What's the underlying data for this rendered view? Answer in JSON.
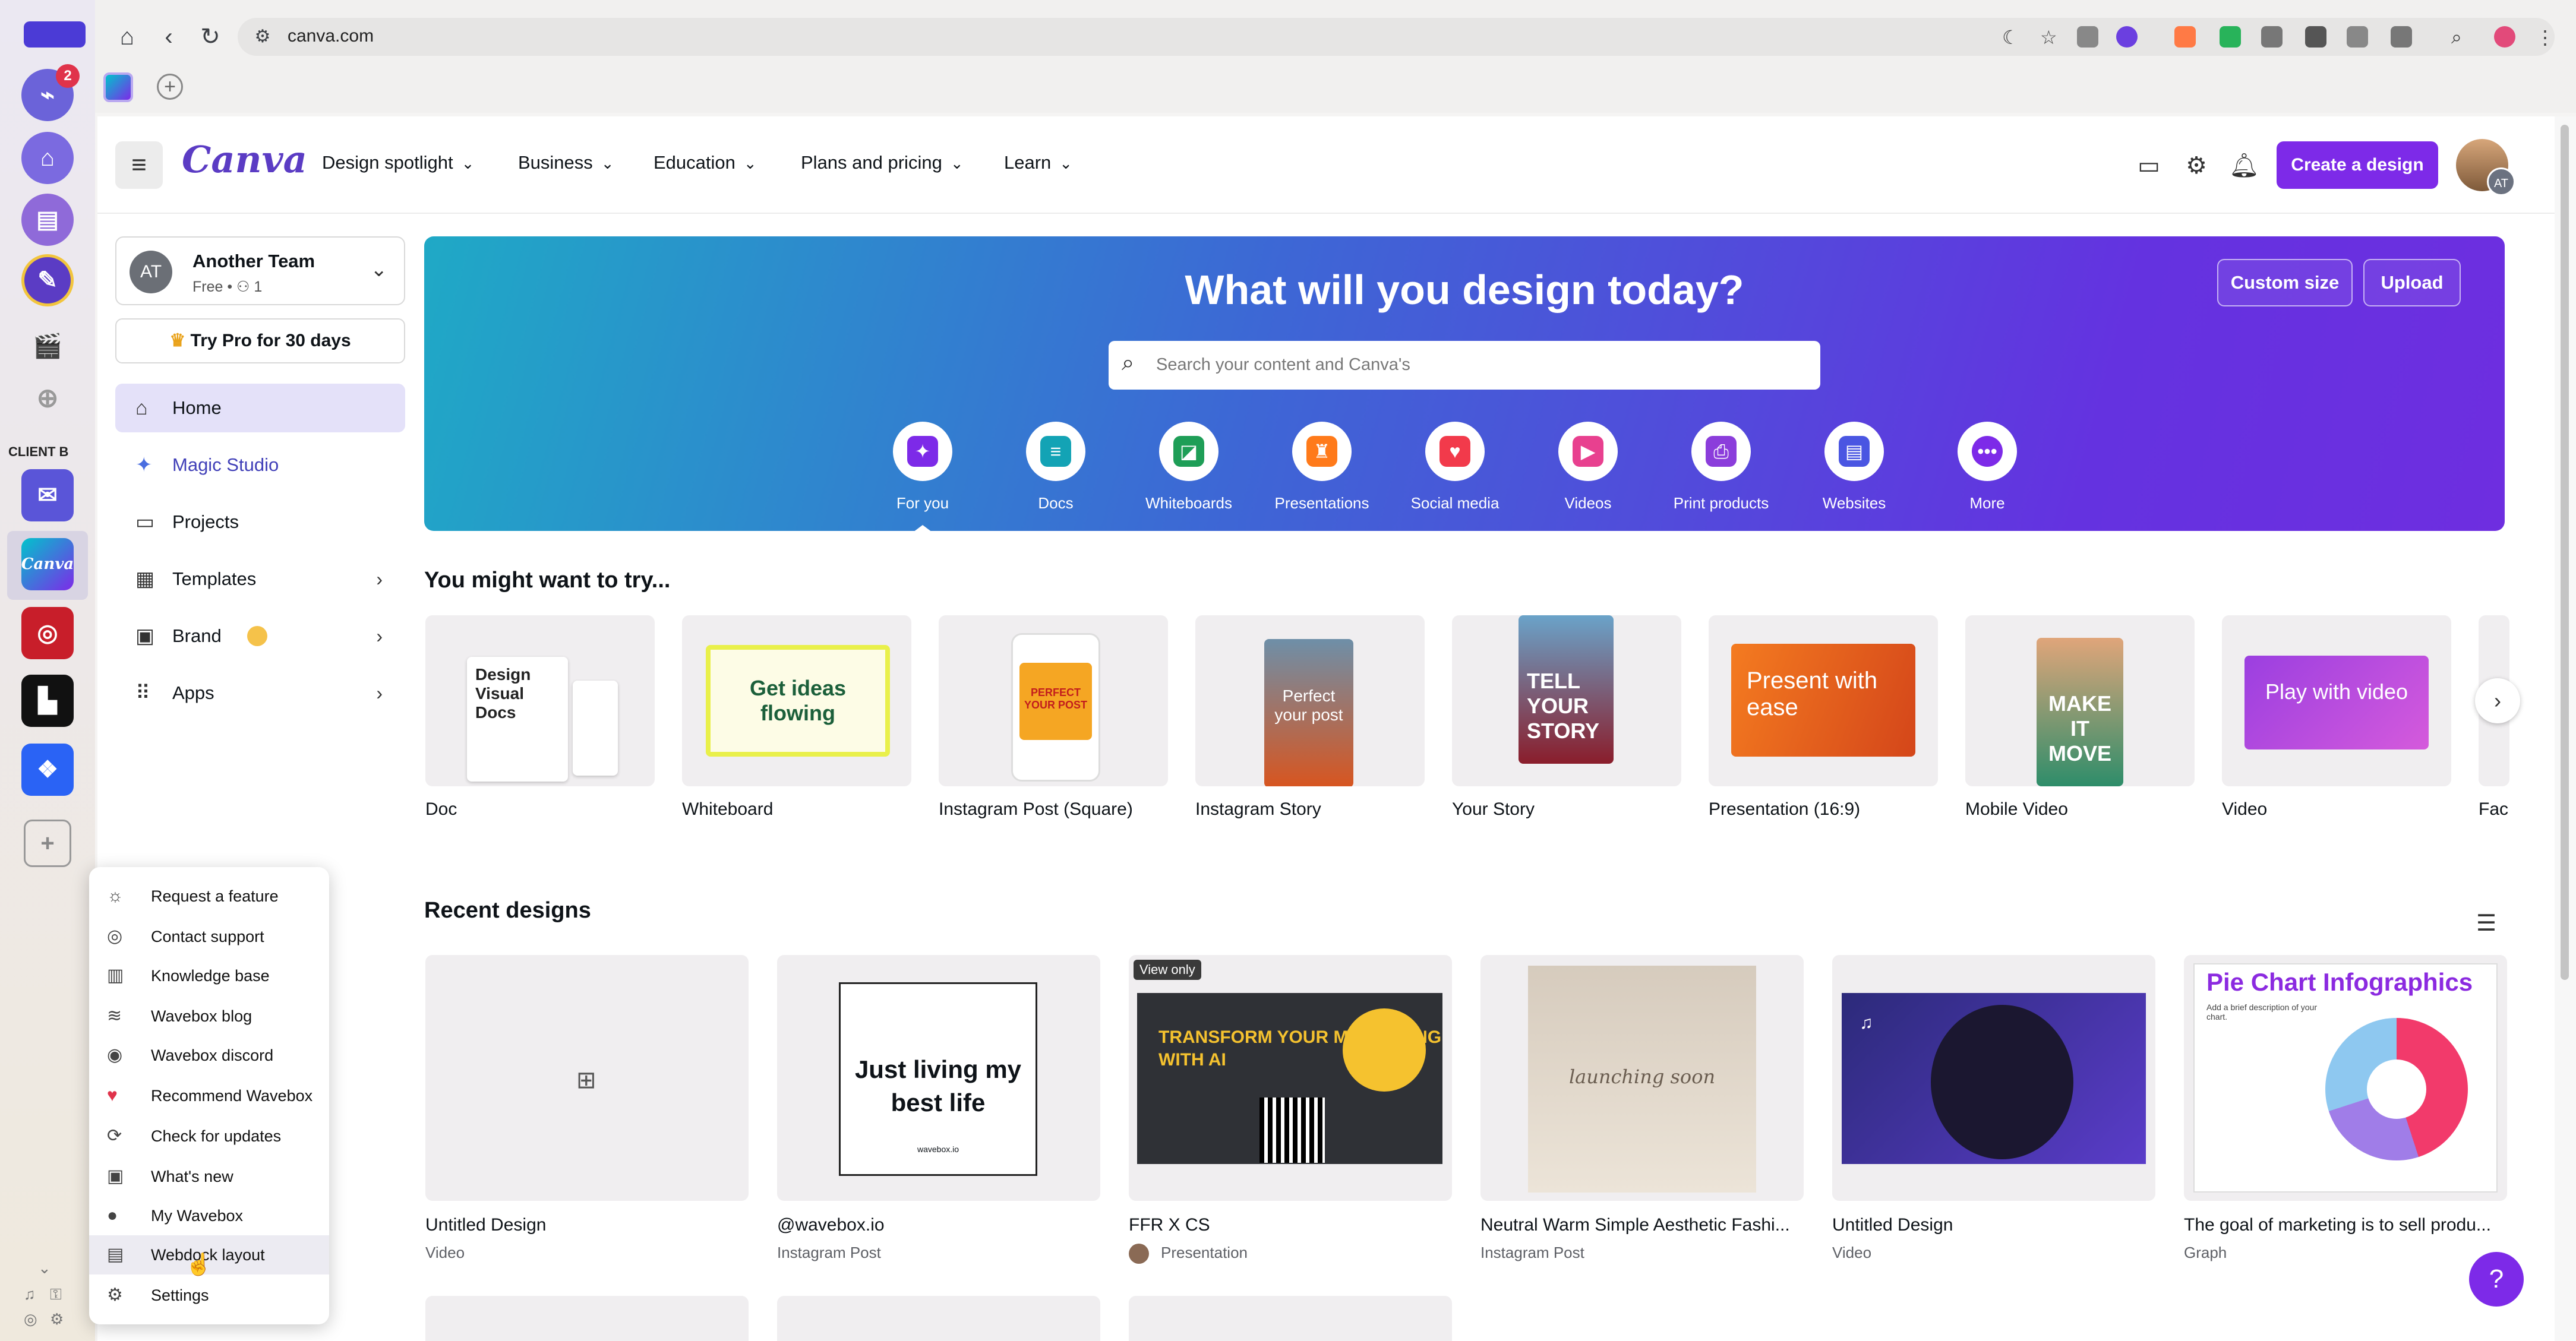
{
  "browser": {
    "url": "canva.com"
  },
  "rail": {
    "badge_count": "2",
    "group_label": "CLIENT B"
  },
  "canva": {
    "logo": "Canva",
    "menu": [
      {
        "label": "Design spotlight"
      },
      {
        "label": "Business"
      },
      {
        "label": "Education"
      },
      {
        "label": "Plans and pricing"
      },
      {
        "label": "Learn"
      }
    ],
    "create_label": "Create a design",
    "avatar_initials": "AT"
  },
  "sidebar": {
    "team_initials": "AT",
    "team_name": "Another Team",
    "team_sub": "Free • ⚇ 1",
    "try_pro": "Try Pro for 30 days",
    "items": [
      {
        "label": "Home",
        "icon": "home-icon"
      },
      {
        "label": "Magic Studio",
        "icon": "sparkle-icon"
      },
      {
        "label": "Projects",
        "icon": "folder-icon"
      },
      {
        "label": "Templates",
        "icon": "templates-icon"
      },
      {
        "label": "Brand",
        "icon": "brand-icon"
      },
      {
        "label": "Apps",
        "icon": "apps-icon"
      }
    ]
  },
  "hero": {
    "title": "What will you design today?",
    "custom_size": "Custom size",
    "upload": "Upload",
    "search_placeholder": "Search your content and Canva's",
    "categories": [
      {
        "label": "For you",
        "color": "#ffffff",
        "inner": "#7d2ae8"
      },
      {
        "label": "Docs",
        "color": "#ffffff",
        "inner": "#13a3b5"
      },
      {
        "label": "Whiteboards",
        "color": "#ffffff",
        "inner": "#1e9e57"
      },
      {
        "label": "Presentations",
        "color": "#ffffff",
        "inner": "#ff7a1a"
      },
      {
        "label": "Social media",
        "color": "#ffffff",
        "inner": "#f23a4b"
      },
      {
        "label": "Videos",
        "color": "#ffffff",
        "inner": "#e8408f"
      },
      {
        "label": "Print products",
        "color": "#ffffff",
        "inner": "#8b3ddb"
      },
      {
        "label": "Websites",
        "color": "#ffffff",
        "inner": "#4a56e2"
      },
      {
        "label": "More",
        "color": "#ffffff",
        "inner": "#7d2ae8"
      }
    ]
  },
  "suggestions": {
    "title": "You might want to try...",
    "items": [
      {
        "label": "Doc"
      },
      {
        "label": "Whiteboard"
      },
      {
        "label": "Instagram Post (Square)"
      },
      {
        "label": "Instagram Story"
      },
      {
        "label": "Your Story"
      },
      {
        "label": "Presentation (16:9)"
      },
      {
        "label": "Mobile Video"
      },
      {
        "label": "Video"
      },
      {
        "label": "Fac"
      }
    ],
    "art_text": {
      "doc": "Design Visual Docs",
      "whiteboard": "Get ideas flowing",
      "ig_post": "PERFECT YOUR POST",
      "ig_story": "Perfect your post",
      "your_story": "TELL YOUR STORY",
      "presentation": "Present with ease",
      "mobile_video": "MAKE IT MOVE",
      "video": "Play with video"
    }
  },
  "recent": {
    "title": "Recent designs",
    "view_only": "View only",
    "items": [
      {
        "title": "Untitled Design",
        "sub": "Video"
      },
      {
        "title": "@wavebox.io",
        "sub": "Instagram Post"
      },
      {
        "title": "FFR X CS",
        "sub": "Presentation"
      },
      {
        "title": "Neutral Warm Simple Aesthetic Fashi...",
        "sub": "Instagram Post"
      },
      {
        "title": "Untitled Design",
        "sub": "Video"
      },
      {
        "title": "The goal of marketing is to sell produ...",
        "sub": "Graph"
      }
    ],
    "art_text": {
      "just_living": "Just living my best life",
      "wavebox_small": "wavebox.io",
      "transform": "TRANSFORM YOUR MARKETING WITH AI",
      "launching": "launching soon",
      "pie_title": "Pie Chart Infographics",
      "pie_sub": "Add a brief description of your chart."
    }
  },
  "popup_menu": {
    "items": [
      {
        "label": "Request a feature",
        "icon": "lightbulb-icon"
      },
      {
        "label": "Contact support",
        "icon": "lifebuoy-icon"
      },
      {
        "label": "Knowledge base",
        "icon": "book-icon"
      },
      {
        "label": "Wavebox blog",
        "icon": "rss-icon"
      },
      {
        "label": "Wavebox discord",
        "icon": "discord-icon"
      },
      {
        "label": "Recommend Wavebox",
        "icon": "heart-icon"
      },
      {
        "label": "Check for updates",
        "icon": "update-icon"
      },
      {
        "label": "What's new",
        "icon": "gift-icon"
      },
      {
        "label": "My Wavebox",
        "icon": "account-icon"
      },
      {
        "label": "Webdock layout",
        "icon": "layout-icon"
      },
      {
        "label": "Settings",
        "icon": "gear-icon"
      }
    ]
  },
  "colors": {
    "accent": "#7d2ae8",
    "brand_purple": "#5b3cc4"
  }
}
